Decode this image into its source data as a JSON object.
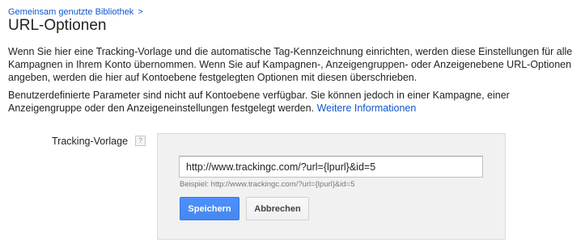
{
  "breadcrumb": {
    "link": "Gemeinsam genutzte Bibliothek",
    "separator": ">"
  },
  "page_title": "URL-Optionen",
  "paragraphs": {
    "p1": "Wenn Sie hier eine Tracking-Vorlage und die automatische Tag-Kennzeichnung einrichten, werden diese Einstellungen für alle Kampagnen in Ihrem Konto übernommen. Wenn Sie auf Kampagnen-, Anzeigengruppen- oder Anzeigenebene URL-Optionen angeben, werden die hier auf Kontoebene festgelegten Optionen mit diesen überschrieben.",
    "p2_text": "Benutzerdefinierte Parameter sind nicht auf Kontoebene verfügbar. Sie können jedoch in einer Kampagne, einer Anzeigengruppe oder den Anzeigeneinstellungen festgelegt werden.",
    "p2_link": "Weitere Informationen"
  },
  "tracking": {
    "label": "Tracking-Vorlage",
    "help_icon": "help-icon",
    "help_glyph": "?",
    "input_value": "http://www.trackingc.com/?url={lpurl}&id=5",
    "example": "Beispiel: http://www.trackingc.com/?url={lpurl}&id=5"
  },
  "buttons": {
    "save": "Speichern",
    "cancel": "Abbrechen"
  },
  "colors": {
    "link": "#1155cc",
    "primary_button": "#4d90fe",
    "panel_background": "#f1f1f1"
  }
}
